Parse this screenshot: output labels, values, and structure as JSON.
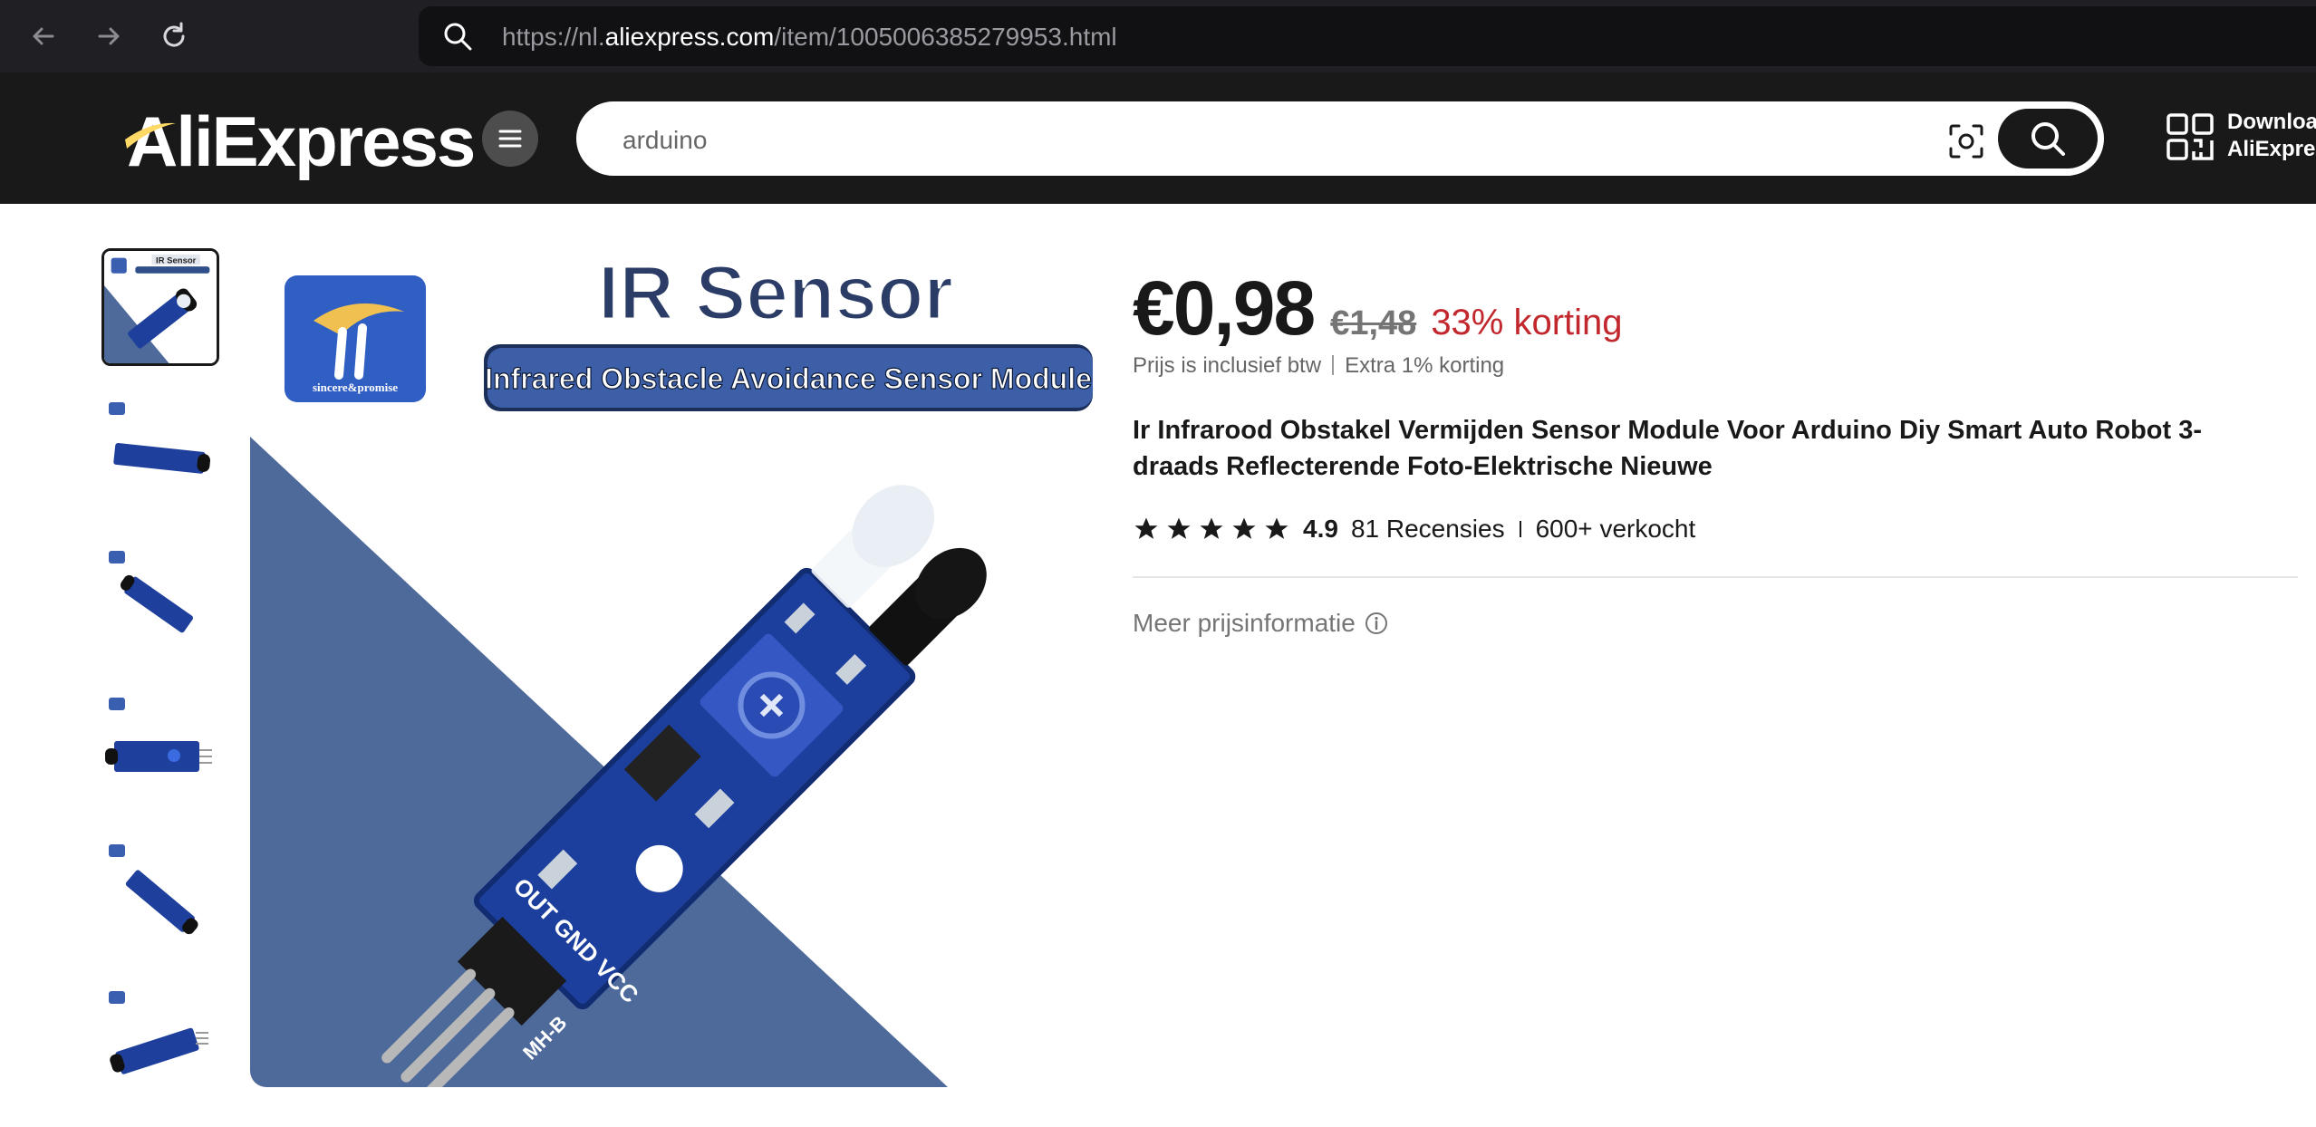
{
  "browser": {
    "url_prefix": "https://nl.",
    "url_host": "aliexpress.com",
    "url_path": "/item/1005006385279953.html"
  },
  "header": {
    "logo_text": "AliExpress",
    "search_value": "arduino",
    "qr_line1": "Download",
    "qr_line2": "AliExpress"
  },
  "thumbnails": [
    {
      "label": "IR Sensor",
      "variant": "cover"
    },
    {
      "variant": "side"
    },
    {
      "variant": "angle"
    },
    {
      "variant": "top"
    },
    {
      "variant": "diagonal"
    },
    {
      "variant": "back"
    }
  ],
  "main_image": {
    "headline": "IR Sensor",
    "subheadline": "Infrared Obstacle Avoidance Sensor Module",
    "brand_line": "sincere&promise",
    "pcb_label": "OUT GND VCC",
    "board_model": "MH-B"
  },
  "product": {
    "price_current": "€0,98",
    "price_original": "€1,48",
    "discount": "33% korting",
    "vat_note": "Prijs is inclusief btw",
    "extra_discount": "Extra 1% korting",
    "title": "Ir Infrarood Obstakel Vermijden Sensor Module Voor Arduino Diy Smart Auto Robot 3-draads Reflecterende Foto-Elektrische Nieuwe",
    "rating": "4.9",
    "reviews": "81 Recensies",
    "sold": "600+ verkocht",
    "more_price_info": "Meer prijsinformatie"
  },
  "colors": {
    "header_bg": "#191919",
    "discount_red": "#c1272d",
    "image_blue": "#4e6a9a",
    "pcb_blue": "#1f3f9c"
  }
}
